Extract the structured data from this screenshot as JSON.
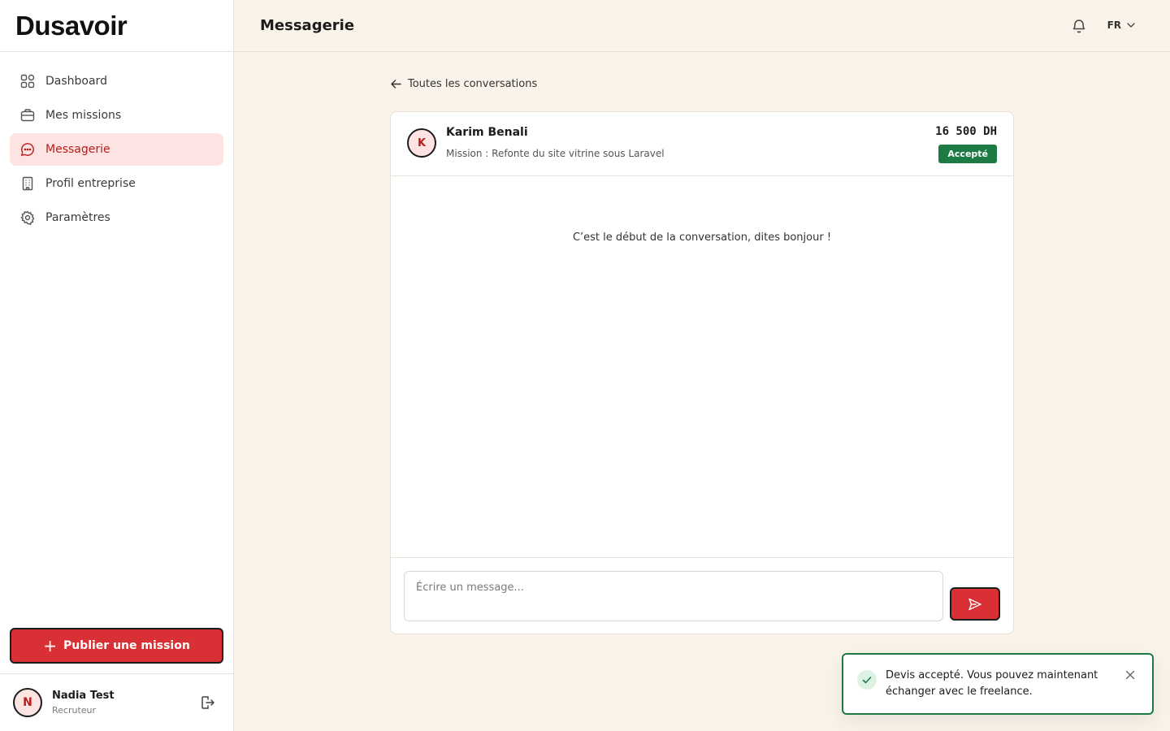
{
  "app": {
    "logo_text": "Dusavoir"
  },
  "sidebar": {
    "items": [
      {
        "label": "Dashboard",
        "icon": "grid-icon",
        "active": false
      },
      {
        "label": "Mes missions",
        "icon": "briefcase-icon",
        "active": false
      },
      {
        "label": "Messagerie",
        "icon": "chat-icon",
        "active": true
      },
      {
        "label": "Profil entreprise",
        "icon": "building-icon",
        "active": false
      },
      {
        "label": "Paramètres",
        "icon": "gear-icon",
        "active": false
      }
    ],
    "publish_label": "Publier une mission",
    "user": {
      "initial": "N",
      "name": "Nadia Test",
      "role": "Recruteur"
    }
  },
  "header": {
    "title": "Messagerie",
    "lang": "FR"
  },
  "main": {
    "back_label": "Toutes les conversations",
    "conversation": {
      "initial": "K",
      "name": "Karim Benali",
      "mission": "Mission : Refonte du site vitrine sous Laravel",
      "price": "16 500 DH",
      "status": "Accepté",
      "empty_message": "C’est le début de la conversation, dites bonjour !"
    },
    "compose": {
      "placeholder": "Écrire un message..."
    }
  },
  "toast": {
    "message": "Devis accepté. Vous pouvez maintenant échanger avec le freelance."
  },
  "colors": {
    "accent": "#d83035",
    "active_bg": "#fde3e1",
    "success": "#1e7a44",
    "page_bg": "#faf3ea"
  }
}
